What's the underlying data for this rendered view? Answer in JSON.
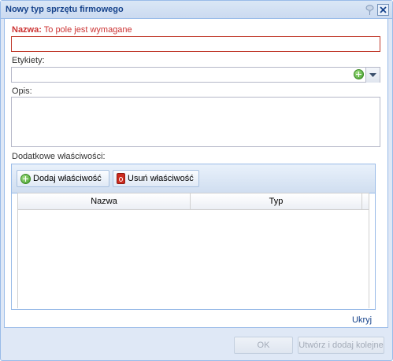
{
  "window": {
    "title": "Nowy typ sprzętu firmowego",
    "pin_icon": "pin-icon",
    "close_icon": "close-icon"
  },
  "form": {
    "name": {
      "label": "Nazwa:",
      "error": "To pole jest wymagane",
      "value": ""
    },
    "tags": {
      "label": "Etykiety:",
      "value": "",
      "add_icon": "add-icon",
      "dropdown_icon": "chevron-down-icon"
    },
    "description": {
      "label": "Opis:",
      "value": ""
    },
    "properties": {
      "label": "Dodatkowe właściwości:",
      "toolbar": {
        "add_label": "Dodaj właściwość",
        "remove_label": "Usuń właściwość"
      },
      "columns": [
        "Nazwa",
        "Typ"
      ],
      "rows": []
    },
    "hide_link": "Ukryj"
  },
  "footer": {
    "ok_label": "OK",
    "create_and_add_label": "Utwórz i dodaj kolejne"
  },
  "colors": {
    "accent": "#15428b",
    "error": "#c33333",
    "border": "#99bbe8",
    "window_bg": "#dfe8f6"
  }
}
